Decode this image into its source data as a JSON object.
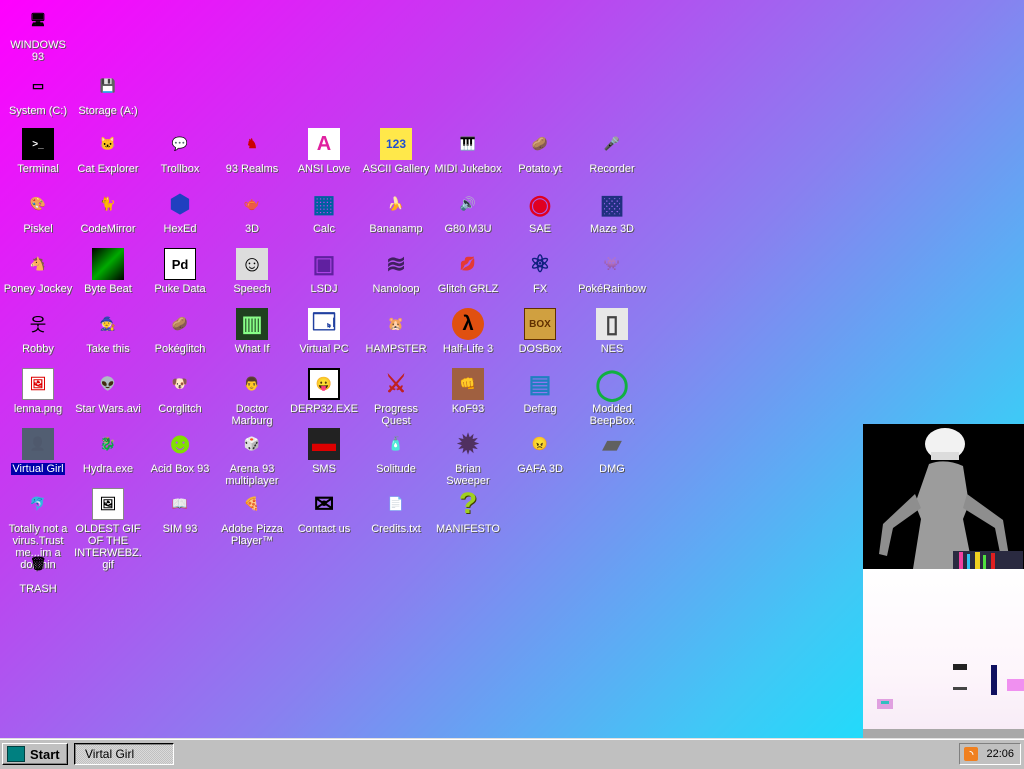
{
  "desktop": {
    "icons": [
      {
        "id": "windows93",
        "label": "WINDOWS 93",
        "glyph": "🖥"
      },
      {
        "id": "system-c",
        "label": "System (C:)",
        "glyph": "▭"
      },
      {
        "id": "storage-a",
        "label": "Storage (A:)",
        "glyph": "💾"
      },
      {
        "id": "terminal",
        "label": "Terminal",
        "glyph": ">_"
      },
      {
        "id": "cat-explorer",
        "label": "Cat Explorer",
        "glyph": "🐱"
      },
      {
        "id": "trollbox",
        "label": "Trollbox",
        "glyph": "💬"
      },
      {
        "id": "93-realms",
        "label": "93 Realms",
        "glyph": "♞"
      },
      {
        "id": "ansi-love",
        "label": "ANSI Love",
        "glyph": "A"
      },
      {
        "id": "ascii-gallery",
        "label": "ASCII Gallery",
        "glyph": "123"
      },
      {
        "id": "midi-jukebox",
        "label": "MIDI Jukebox",
        "glyph": "🎹"
      },
      {
        "id": "potato-yt",
        "label": "Potato.yt",
        "glyph": "🥔"
      },
      {
        "id": "recorder",
        "label": "Recorder",
        "glyph": "🎤"
      },
      {
        "id": "piskel",
        "label": "Piskel",
        "glyph": "🎨"
      },
      {
        "id": "codemirror",
        "label": "CodeMirror",
        "glyph": "🐈"
      },
      {
        "id": "hexed",
        "label": "HexEd",
        "glyph": "⬢"
      },
      {
        "id": "3d",
        "label": "3D",
        "glyph": "🫖"
      },
      {
        "id": "calc",
        "label": "Calc",
        "glyph": "▦"
      },
      {
        "id": "bananamp",
        "label": "Bananamp",
        "glyph": "🍌"
      },
      {
        "id": "g80-m3u",
        "label": "G80.M3U",
        "glyph": "🔊"
      },
      {
        "id": "sae",
        "label": "SAE",
        "glyph": "◉"
      },
      {
        "id": "maze-3d",
        "label": "Maze 3D",
        "glyph": "▩"
      },
      {
        "id": "poney-jockey",
        "label": "Poney Jockey",
        "glyph": "🐴"
      },
      {
        "id": "byte-beat",
        "label": "Byte Beat",
        "glyph": "▚"
      },
      {
        "id": "puke-data",
        "label": "Puke Data",
        "glyph": "Pd"
      },
      {
        "id": "speech",
        "label": "Speech",
        "glyph": "☺"
      },
      {
        "id": "lsdj",
        "label": "LSDJ",
        "glyph": "▣"
      },
      {
        "id": "nanoloop",
        "label": "Nanoloop",
        "glyph": "≋"
      },
      {
        "id": "glitch-grlz",
        "label": "Glitch GRLZ",
        "glyph": "💋"
      },
      {
        "id": "fx",
        "label": "FX",
        "glyph": "⚛"
      },
      {
        "id": "pokerainbow",
        "label": "PokéRainbow",
        "glyph": "👾"
      },
      {
        "id": "robby",
        "label": "Robby",
        "glyph": "웃"
      },
      {
        "id": "take-this",
        "label": "Take this",
        "glyph": "🧙"
      },
      {
        "id": "pokeglitch",
        "label": "Pokéglitch",
        "glyph": "🥔"
      },
      {
        "id": "what-if",
        "label": "What If",
        "glyph": "▥"
      },
      {
        "id": "virtual-pc",
        "label": "Virtual PC",
        "glyph": "🗔"
      },
      {
        "id": "hampster",
        "label": "HAMPSTER",
        "glyph": "🐹"
      },
      {
        "id": "half-life-3",
        "label": "Half-Life 3",
        "glyph": "λ"
      },
      {
        "id": "dosbox",
        "label": "DOSBox",
        "glyph": "BOX"
      },
      {
        "id": "nes",
        "label": "NES",
        "glyph": "▯"
      },
      {
        "id": "lenna-png",
        "label": "lenna.png",
        "glyph": "🖼"
      },
      {
        "id": "star-wars-avi",
        "label": "Star Wars.avi",
        "glyph": "👽"
      },
      {
        "id": "corglitch",
        "label": "Corglitch",
        "glyph": "🐶"
      },
      {
        "id": "doctor-marburg",
        "label": "Doctor Marburg",
        "glyph": "👨"
      },
      {
        "id": "derp32-exe",
        "label": "DERP32.EXE",
        "glyph": "😛"
      },
      {
        "id": "progress-quest",
        "label": "Progress Quest",
        "glyph": "⚔"
      },
      {
        "id": "kof93",
        "label": "KoF93",
        "glyph": "👊"
      },
      {
        "id": "defrag",
        "label": "Defrag",
        "glyph": "▤"
      },
      {
        "id": "modded-beepbox",
        "label": "Modded BeepBox",
        "glyph": "◯"
      },
      {
        "id": "virtual-girl",
        "label": "Virtual Girl",
        "glyph": "👤",
        "selected": true
      },
      {
        "id": "hydra-exe",
        "label": "Hydra.exe",
        "glyph": "🐉"
      },
      {
        "id": "acid-box-93",
        "label": "Acid Box 93",
        "glyph": "☻"
      },
      {
        "id": "arena-93",
        "label": "Arena 93 multiplayer",
        "glyph": "🎲"
      },
      {
        "id": "sms",
        "label": "SMS",
        "glyph": "▬"
      },
      {
        "id": "solitude",
        "label": "Solitude",
        "glyph": "🧴"
      },
      {
        "id": "brian-sweeper",
        "label": "Brian Sweeper",
        "glyph": "✹"
      },
      {
        "id": "gafa-3d",
        "label": "GAFA 3D",
        "glyph": "😠"
      },
      {
        "id": "dmg",
        "label": "DMG",
        "glyph": "▰"
      },
      {
        "id": "totally-not-a-virus",
        "label": "Totally not a virus.Trust me...im a dolphin",
        "glyph": "🐬"
      },
      {
        "id": "oldest-gif",
        "label": "OLDEST GIF OF THE INTERWEBZ.gif",
        "glyph": "🖼"
      },
      {
        "id": "sim-93",
        "label": "SIM 93",
        "glyph": "📖"
      },
      {
        "id": "adobe-pizza",
        "label": "Adobe Pizza Player™",
        "glyph": "🍕"
      },
      {
        "id": "contact-us",
        "label": "Contact us",
        "glyph": "✉"
      },
      {
        "id": "credits-txt",
        "label": "Credits.txt",
        "glyph": "📄"
      },
      {
        "id": "manifesto",
        "label": "MANIFESTO",
        "glyph": "?"
      },
      {
        "id": "trash",
        "label": "TRASH",
        "glyph": "🗑"
      }
    ]
  },
  "taskbar": {
    "start_label": "Start",
    "task_label": "Virtal Girl",
    "clock": "22:06"
  }
}
